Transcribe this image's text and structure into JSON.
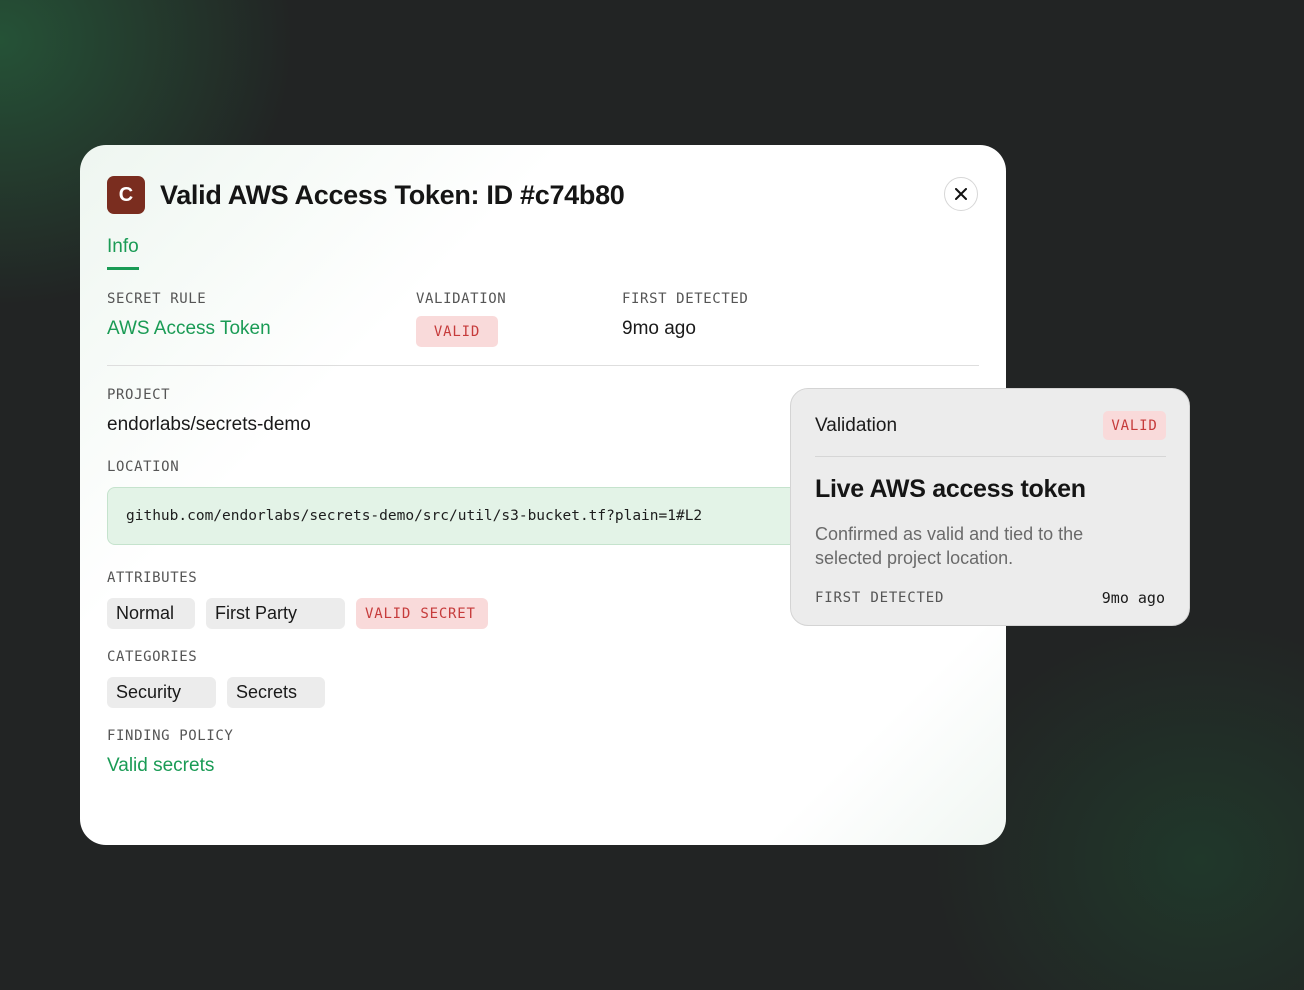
{
  "header": {
    "icon_letter": "C",
    "title": "Valid AWS Access Token: ID #c74b80"
  },
  "tabs": [
    {
      "label": "Info",
      "active": true
    }
  ],
  "summary": {
    "secret_rule_label": "SECRET RULE",
    "secret_rule_value": "AWS Access Token",
    "validation_label": "VALIDATION",
    "validation_badge": "VALID",
    "first_detected_label": "FIRST DETECTED",
    "first_detected_value": "9mo ago"
  },
  "project": {
    "label": "PROJECT",
    "value": "endorlabs/secrets-demo"
  },
  "location": {
    "label": "LOCATION",
    "value": "github.com/endorlabs/secrets-demo/src/util/s3-bucket.tf?plain=1#L2"
  },
  "attributes": {
    "label": "ATTRIBUTES",
    "items": [
      "Normal",
      "First Party",
      "VALID SECRET"
    ]
  },
  "categories": {
    "label": "CATEGORIES",
    "items": [
      "Security",
      "Secrets"
    ]
  },
  "finding_policy": {
    "label": "FINDING POLICY",
    "value": "Valid secrets"
  },
  "popover": {
    "title": "Validation",
    "badge": "VALID",
    "heading": "Live AWS access token",
    "description": "Confirmed as valid and tied to the selected project location.",
    "first_detected_label": "FIRST DETECTED",
    "first_detected_value": "9mo ago"
  },
  "colors": {
    "accent_green": "#1a9b55",
    "badge_red_text": "#c63b3b",
    "badge_red_bg": "#f9dada",
    "header_icon_bg": "#7a2d1f",
    "background": "#222424"
  },
  "icons": {
    "close": "close-icon"
  }
}
